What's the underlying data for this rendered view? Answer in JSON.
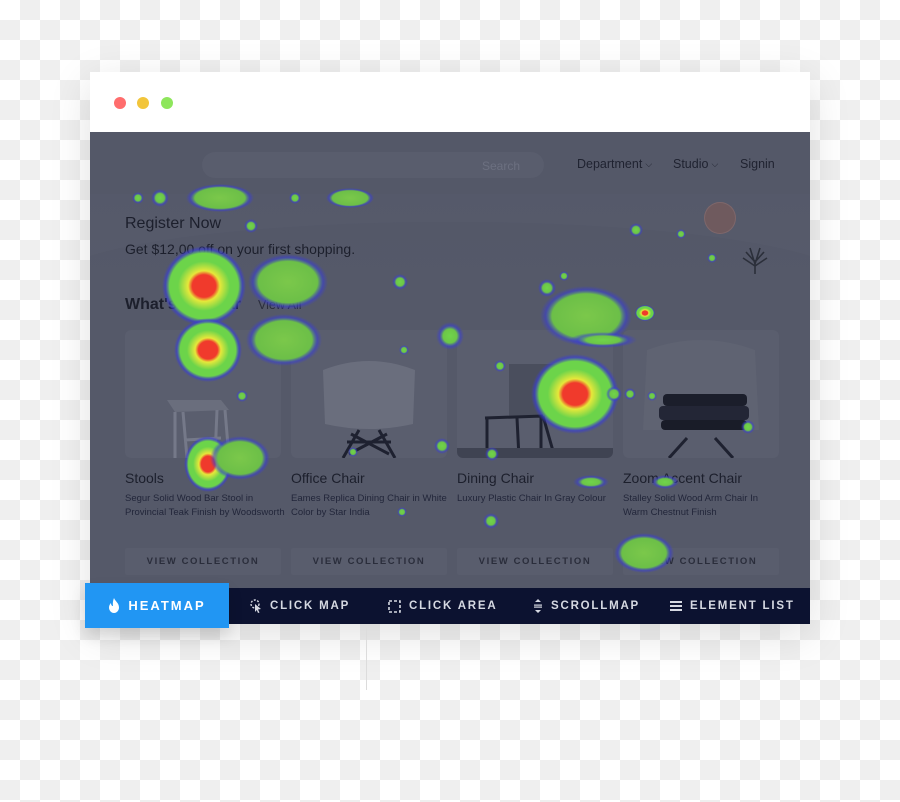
{
  "window": {
    "controls": [
      "close",
      "minimize",
      "maximize"
    ],
    "control_colors": {
      "close": "#ff6d6d",
      "minimize": "#f2c53b",
      "maximize": "#8ee65c"
    }
  },
  "site": {
    "search": {
      "placeholder": "Search",
      "value": ""
    },
    "nav": [
      {
        "label": "Department",
        "has_dropdown": true
      },
      {
        "label": "Studio",
        "has_dropdown": true
      },
      {
        "label": "Signin",
        "has_dropdown": false
      }
    ],
    "hero": {
      "title": "Register Now",
      "subtitle": "Get $12,00 off on your first shopping."
    },
    "popular": {
      "title": "What's Popular",
      "view_all": "View All"
    },
    "products": [
      {
        "name": "Stools",
        "description": "Segur Solid Wood Bar Stool in Provincial Teak Finish by Woodsworth",
        "button": "VIEW COLLECTION"
      },
      {
        "name": "Office Chair",
        "description": "Eames Replica Dining Chair in White Color by Star India",
        "button": "VIEW COLLECTION"
      },
      {
        "name": "Dining Chair",
        "description": "Luxury Plastic Chair In Gray Colour",
        "button": "VIEW COLLECTION"
      },
      {
        "name": "Zoom Accent Chair",
        "description": "Stalley Solid Wood Arm Chair In Warm Chestnut Finish",
        "button": "VIEW COLLECTION"
      }
    ]
  },
  "toolbar": {
    "active_tab": "HEATMAP",
    "active_color": "#2196f3",
    "background_color": "#0c1230",
    "tabs": [
      {
        "label": "HEATMAP",
        "icon": "flame-icon"
      },
      {
        "label": "CLICK MAP",
        "icon": "pointer-click-icon"
      },
      {
        "label": "CLICK AREA",
        "icon": "dashed-square-icon"
      },
      {
        "label": "SCROLLMAP",
        "icon": "scroll-arrows-icon"
      },
      {
        "label": "ELEMENT LIST",
        "icon": "list-icon"
      }
    ]
  },
  "heatmap": {
    "color_scale": [
      "#3b3fd0",
      "#6cd44a",
      "#e6e83a",
      "#f03a2c"
    ],
    "hotspots": [
      {
        "target": "whats-popular-title",
        "intensity": "high"
      },
      {
        "target": "stools-image",
        "intensity": "high"
      },
      {
        "target": "stools-title",
        "intensity": "high"
      },
      {
        "target": "dining-chair-image",
        "intensity": "high"
      },
      {
        "target": "view-all-link",
        "intensity": "medium"
      },
      {
        "target": "dining-chair-card-top",
        "intensity": "medium"
      },
      {
        "target": "zoom-accent-view-collection",
        "intensity": "medium"
      },
      {
        "target": "nav-area",
        "intensity": "low"
      }
    ]
  }
}
